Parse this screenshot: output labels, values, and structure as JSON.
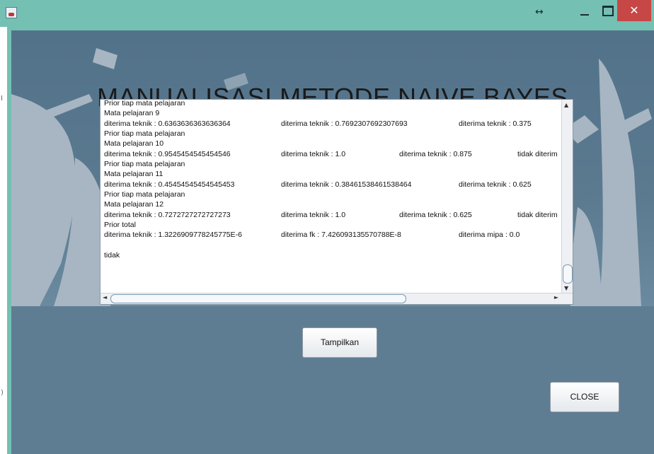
{
  "window": {
    "icon": "java-cup-icon",
    "controls": {
      "resize": "↔",
      "close": "✕"
    }
  },
  "title": "MANUALISASI METODE NAIVE BAYES",
  "output_lines": [
    "Prior tiap mata pelajaran",
    "Mata pelajaran 9",
    "diterima teknik : 0.6363636363636364",
    "Prior tiap mata pelajaran",
    "Mata pelajaran 10",
    "diterima teknik : 0.9545454545454546",
    "Prior tiap mata pelajaran",
    "Mata pelajaran 11",
    "diterima teknik : 0.45454545454545453",
    "Prior tiap mata pelajaran",
    "Mata pelajaran 12",
    "diterima teknik : 0.7272727272727273",
    "Prior total",
    "diterima teknik : 1.3226909778245775E-6",
    "",
    "tidak"
  ],
  "output_col2": {
    "r2": "diterima teknik : 0.7692307692307693",
    "r5": "diterima teknik : 1.0",
    "r8": "diterima teknik : 0.38461538461538464",
    "r11": "diterima teknik : 1.0",
    "r13": "diterima fk : 7.426093135570788E-8"
  },
  "output_col3": {
    "r2": "diterima teknik : 0.375",
    "r5": "diterima teknik : 0.875",
    "r8": "diterima teknik : 0.625",
    "r11": "diterima teknik : 0.625",
    "r13": "diterima mipa : 0.0"
  },
  "output_col4": {
    "r5": "tidak diterim",
    "r11": "tidak diterim"
  },
  "scroll": {
    "up": "▲",
    "down": "▼",
    "left": "◄",
    "right": "►"
  },
  "buttons": {
    "tampilkan": "Tampilkan",
    "close": "CLOSE"
  },
  "left_edge_marks": [
    "I",
    ")"
  ]
}
